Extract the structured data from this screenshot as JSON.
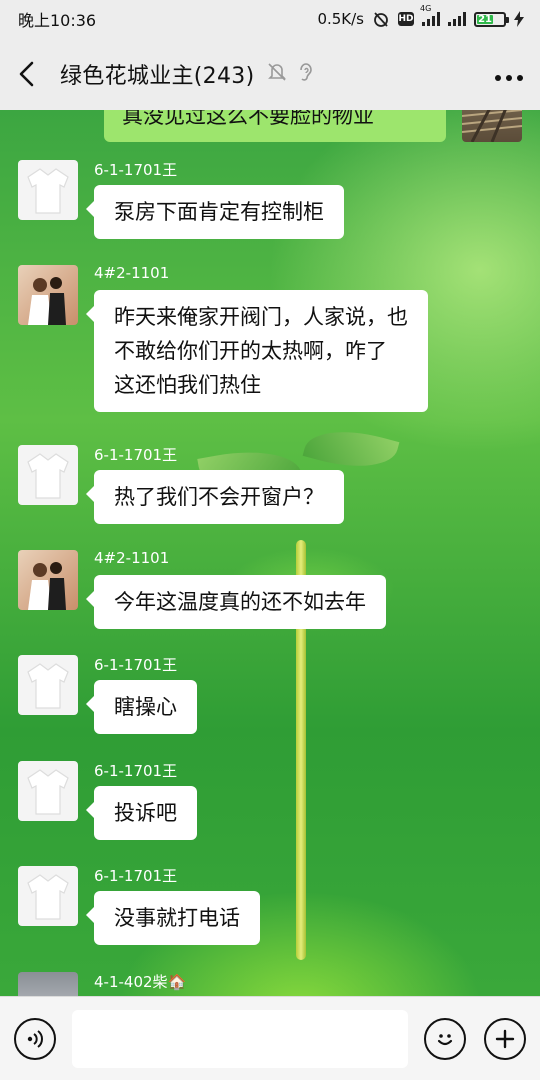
{
  "status_bar": {
    "time": "晚上10:36",
    "speed": "0.5K/s",
    "network_label": "4G",
    "hd_label": "HD",
    "battery": "21"
  },
  "header": {
    "title": "绿色花城业主(243)"
  },
  "chat": {
    "my_partial_message": "真没见过这么不要脸的物业",
    "messages": [
      {
        "name": "6-1-1701王",
        "text": "泵房下面肯定有控制柜",
        "avatar": "white-shirt"
      },
      {
        "name": "4#2-1101",
        "text": "昨天来俺家开阀门，人家说，也\n不敢给你们开的太热啊，咋了\n这还怕我们热住",
        "avatar": "couple"
      },
      {
        "name": "6-1-1701王",
        "text": "热了我们不会开窗户？",
        "avatar": "white-shirt"
      },
      {
        "name": "4#2-1101",
        "text": "今年这温度真的还不如去年",
        "avatar": "couple"
      },
      {
        "name": "6-1-1701王",
        "text": "瞎操心",
        "avatar": "white-shirt"
      },
      {
        "name": "6-1-1701王",
        "text": "投诉吧",
        "avatar": "white-shirt"
      },
      {
        "name": "6-1-1701王",
        "text": "没事就打电话",
        "avatar": "white-shirt"
      },
      {
        "name": "4-1-402柴🏠",
        "text": "",
        "avatar": "gray"
      }
    ]
  },
  "input": {
    "value": ""
  },
  "icons": {
    "back": "chevron-left-icon",
    "mute": "bell-off-icon",
    "ear": "ear-icon",
    "more": "more-icon",
    "voice": "voice-icon",
    "emoji": "emoji-icon",
    "plus": "plus-icon"
  },
  "colors": {
    "header_bg": "#ededed",
    "my_bubble": "#9de56d",
    "bubble": "#ffffff",
    "battery_fill": "#2fb84a"
  }
}
